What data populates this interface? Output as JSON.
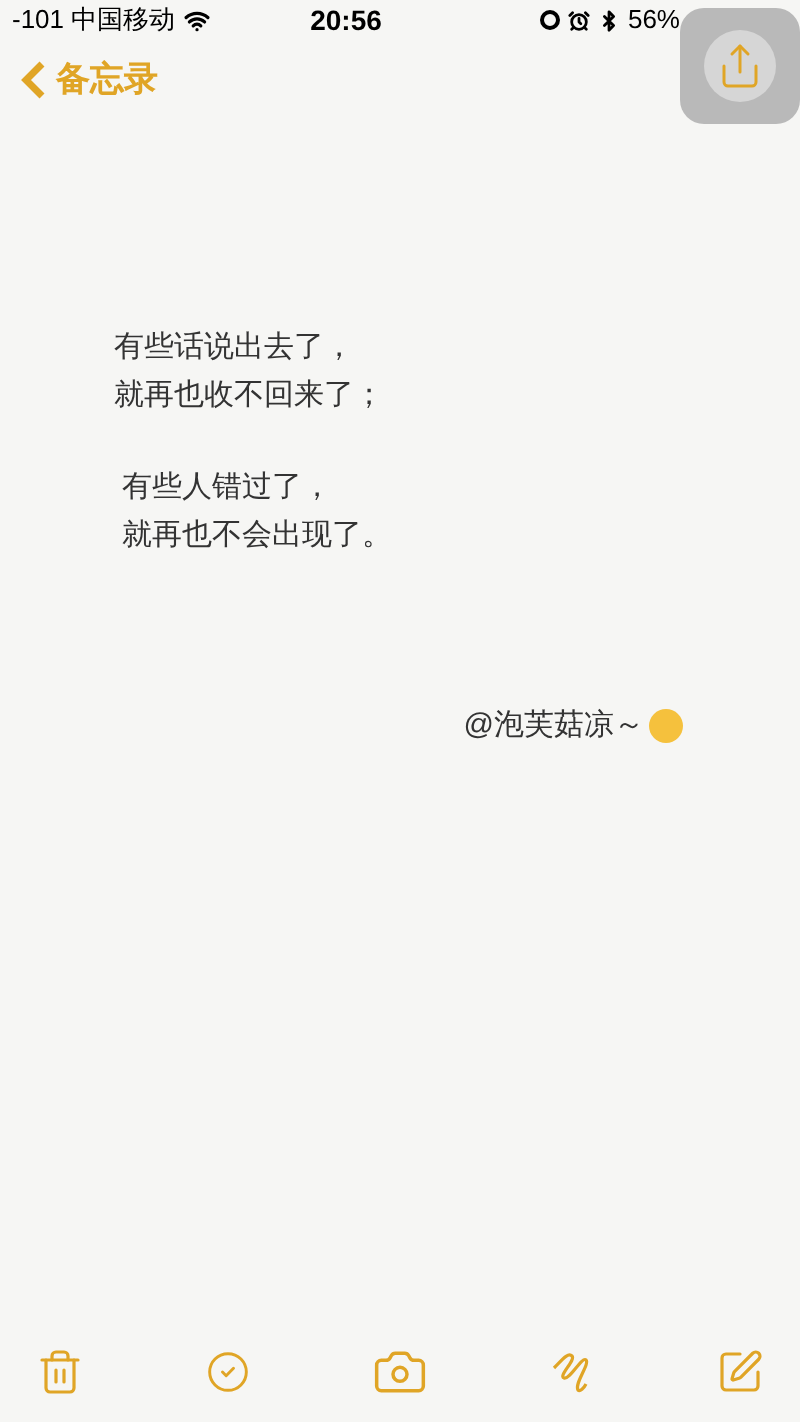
{
  "status_bar": {
    "carrier": "-101 中国移动",
    "time": "20:56",
    "battery": "56%"
  },
  "nav": {
    "back": "备忘录"
  },
  "note": {
    "paragraphs": [
      [
        "有些话说出去了，",
        "就再也收不回来了；"
      ],
      [
        "有些人错过了，",
        "就再也不会出现了。"
      ]
    ],
    "signature": "@泡芙菇凉～"
  }
}
